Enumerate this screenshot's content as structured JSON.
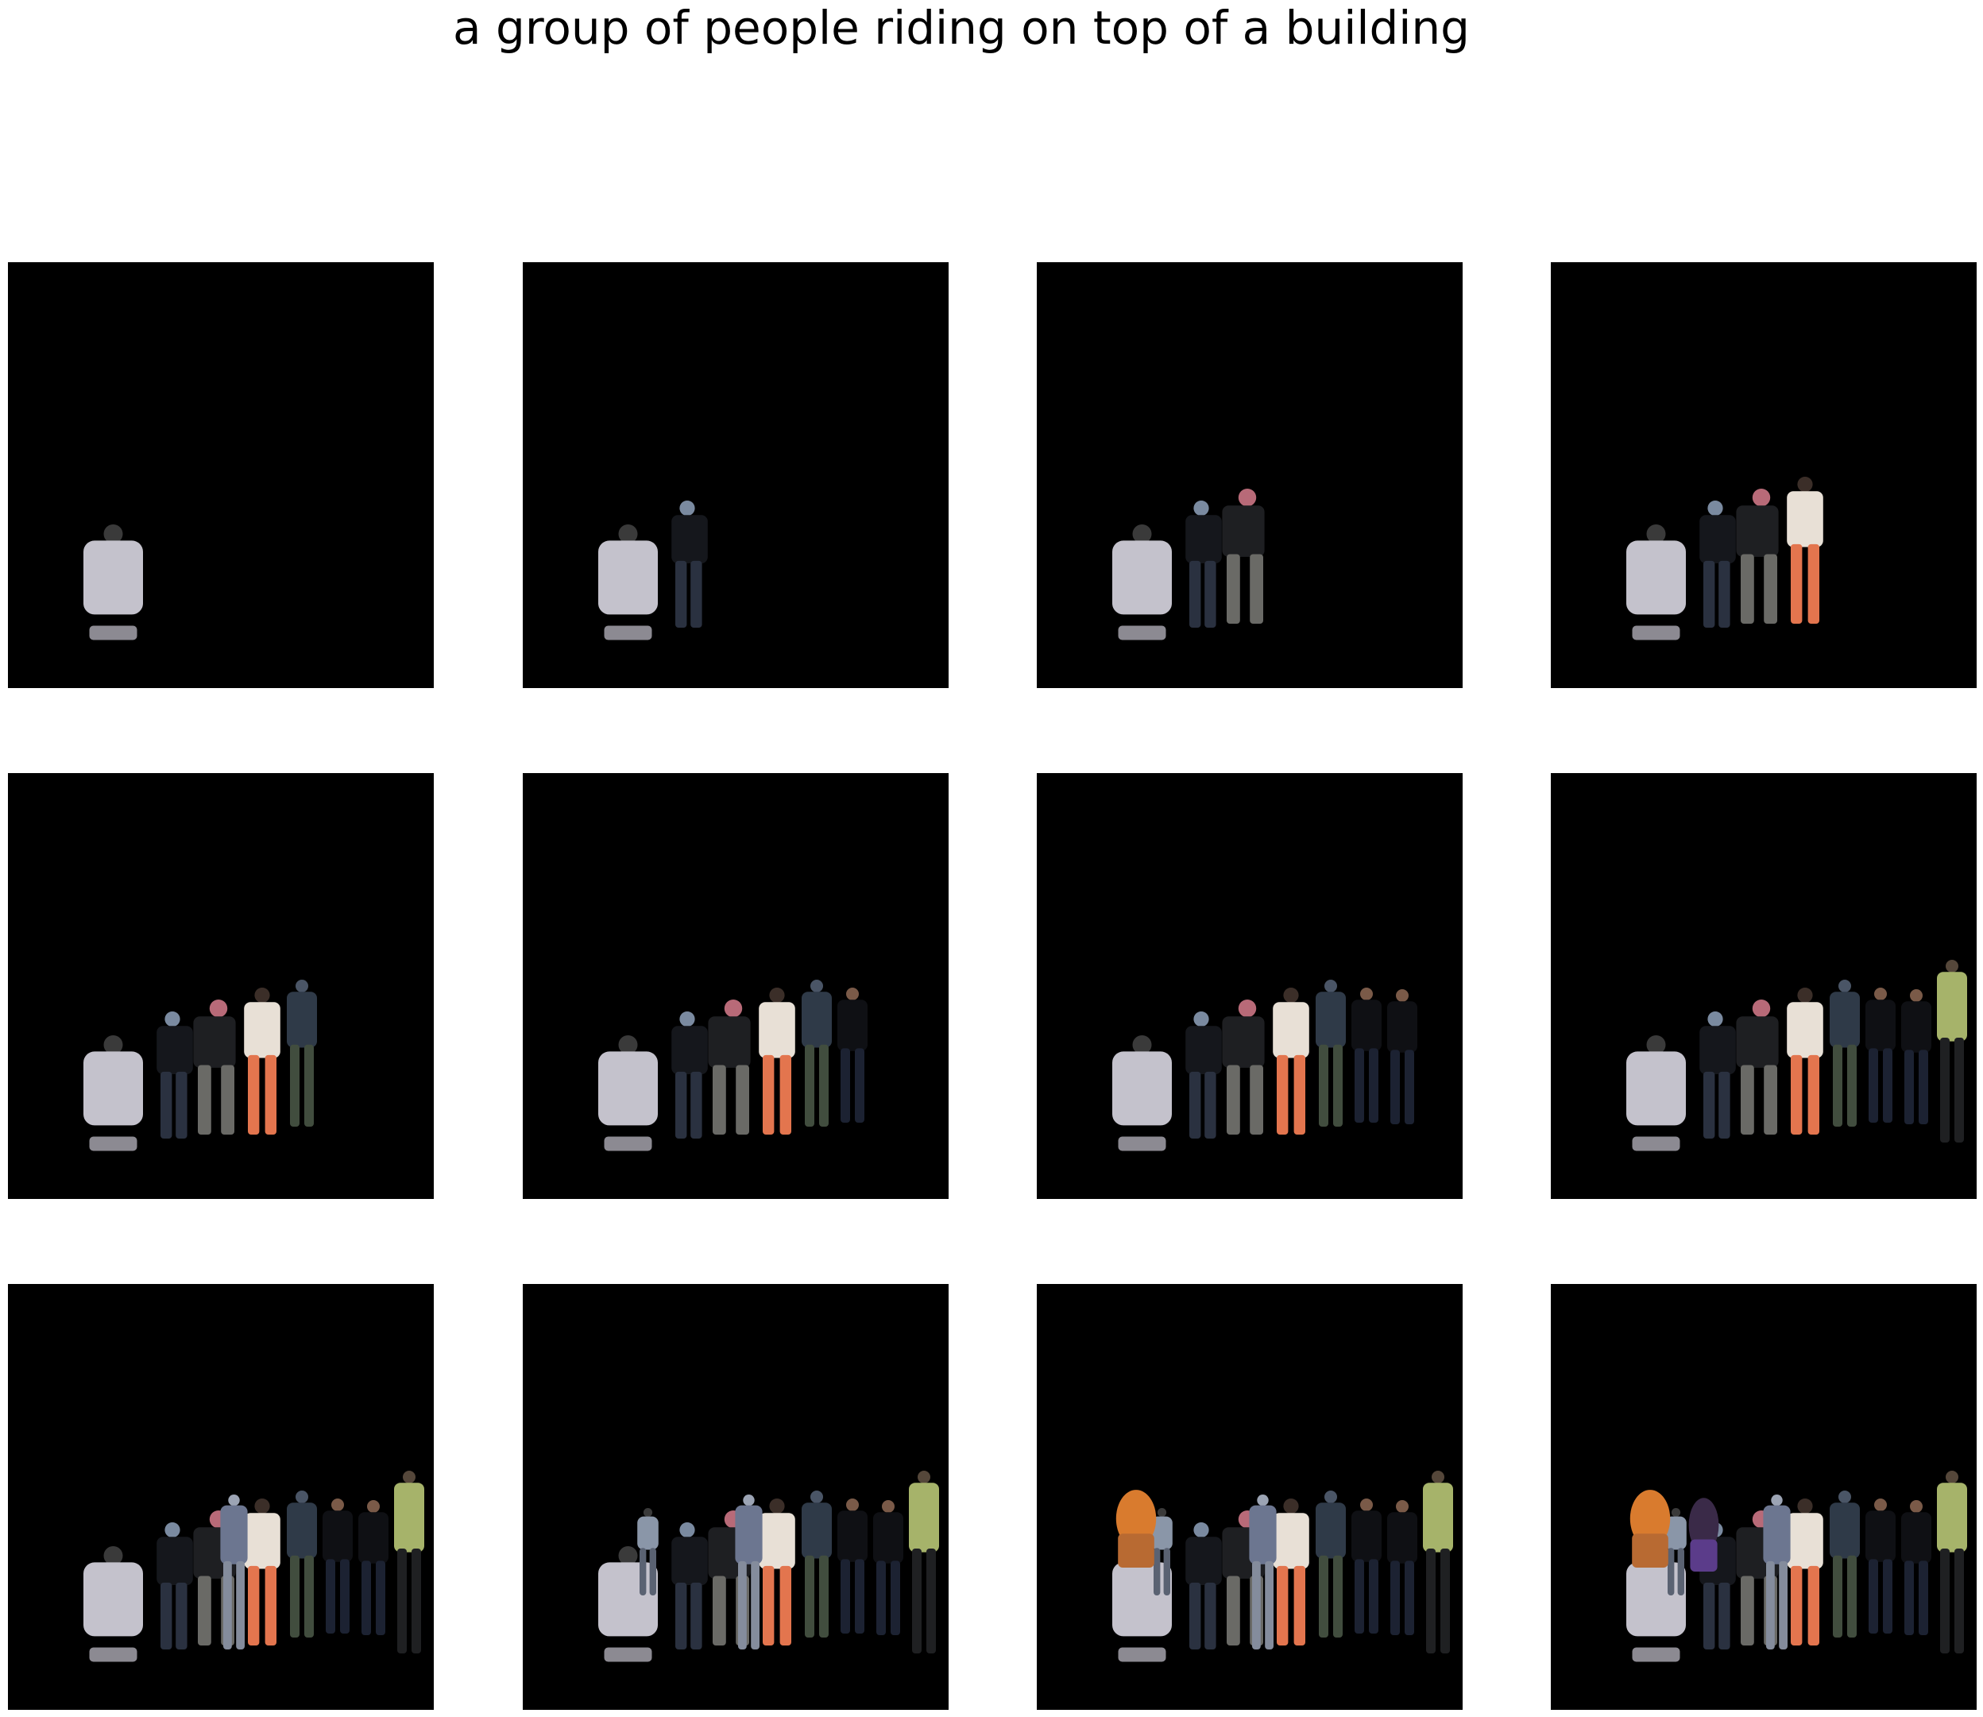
{
  "caption": "a group of people riding on top of a building",
  "colors": {
    "background": "#ffffff",
    "panel_background": "#000000"
  },
  "figures": [
    {
      "id": "hoodie-person",
      "head": "#3a3a3a",
      "body": "#c4c2cc",
      "legs": "#8c8a92"
    },
    {
      "id": "dark-crouching-person",
      "head": "#7a8aa0",
      "body": "#15171c",
      "legs": "#2a3140"
    },
    {
      "id": "red-cap-person",
      "head": "#b86a78",
      "body": "#1e1f22",
      "legs": "#6a6a66"
    },
    {
      "id": "woman-white-dress",
      "head": "#3b2e28",
      "body": "#e8e0d6",
      "legs": "#e3754e"
    },
    {
      "id": "standing-person-grey",
      "head": "#4a5566",
      "body": "#2f3a48",
      "legs": "#414d3e"
    },
    {
      "id": "man-suit-1",
      "head": "#7a5a48",
      "body": "#0f1014",
      "legs": "#1c2232"
    },
    {
      "id": "man-suit-2",
      "head": "#7a5a48",
      "body": "#0f1014",
      "legs": "#1c2232"
    },
    {
      "id": "man-green-shirt",
      "head": "#55473a",
      "body": "#a6b36a",
      "legs": "#1f2022"
    },
    {
      "id": "blurred-person",
      "head": "#9ca4b4",
      "body": "#6c7690",
      "legs": "#848c9c"
    },
    {
      "id": "small-person",
      "head": "#3a3a3a",
      "body": "#8a96a8",
      "legs": "#5a6272"
    },
    {
      "id": "orange-hair-person",
      "head": "#d97b2e",
      "body": "#b86a32",
      "legs": "#5a3a28"
    },
    {
      "id": "purple-person",
      "head": "#3a2a48",
      "body": "#5b3c8a",
      "legs": "#2a2040"
    }
  ],
  "panels": [
    {
      "name": "step-1",
      "figure_ids": [
        "hoodie-person"
      ]
    },
    {
      "name": "step-2",
      "figure_ids": [
        "hoodie-person",
        "dark-crouching-person"
      ]
    },
    {
      "name": "step-3",
      "figure_ids": [
        "hoodie-person",
        "dark-crouching-person",
        "red-cap-person"
      ]
    },
    {
      "name": "step-4",
      "figure_ids": [
        "hoodie-person",
        "dark-crouching-person",
        "red-cap-person",
        "woman-white-dress"
      ]
    },
    {
      "name": "step-5",
      "figure_ids": [
        "hoodie-person",
        "dark-crouching-person",
        "red-cap-person",
        "woman-white-dress",
        "standing-person-grey"
      ]
    },
    {
      "name": "step-6",
      "figure_ids": [
        "hoodie-person",
        "dark-crouching-person",
        "red-cap-person",
        "woman-white-dress",
        "standing-person-grey",
        "man-suit-1"
      ]
    },
    {
      "name": "step-7",
      "figure_ids": [
        "hoodie-person",
        "dark-crouching-person",
        "red-cap-person",
        "woman-white-dress",
        "standing-person-grey",
        "man-suit-1",
        "man-suit-2"
      ]
    },
    {
      "name": "step-8",
      "figure_ids": [
        "hoodie-person",
        "dark-crouching-person",
        "red-cap-person",
        "woman-white-dress",
        "standing-person-grey",
        "man-suit-1",
        "man-suit-2",
        "man-green-shirt"
      ]
    },
    {
      "name": "step-9",
      "figure_ids": [
        "hoodie-person",
        "dark-crouching-person",
        "red-cap-person",
        "woman-white-dress",
        "standing-person-grey",
        "man-suit-1",
        "man-suit-2",
        "man-green-shirt",
        "blurred-person"
      ]
    },
    {
      "name": "step-10",
      "figure_ids": [
        "hoodie-person",
        "dark-crouching-person",
        "red-cap-person",
        "woman-white-dress",
        "standing-person-grey",
        "man-suit-1",
        "man-suit-2",
        "man-green-shirt",
        "blurred-person",
        "small-person"
      ]
    },
    {
      "name": "step-11",
      "figure_ids": [
        "hoodie-person",
        "dark-crouching-person",
        "red-cap-person",
        "woman-white-dress",
        "standing-person-grey",
        "man-suit-1",
        "man-suit-2",
        "man-green-shirt",
        "blurred-person",
        "small-person",
        "orange-hair-person"
      ]
    },
    {
      "name": "step-12",
      "figure_ids": [
        "hoodie-person",
        "dark-crouching-person",
        "red-cap-person",
        "woman-white-dress",
        "standing-person-grey",
        "man-suit-1",
        "man-suit-2",
        "man-green-shirt",
        "blurred-person",
        "small-person",
        "orange-hair-person",
        "purple-person"
      ]
    }
  ]
}
